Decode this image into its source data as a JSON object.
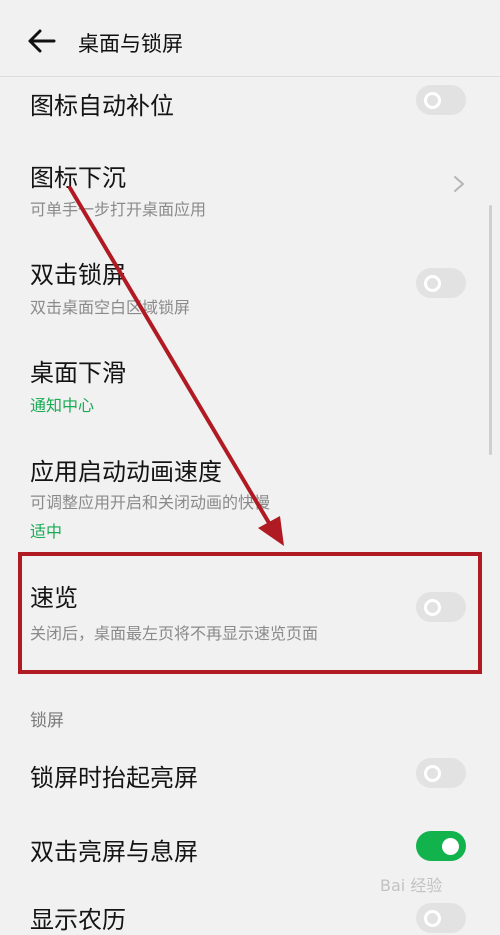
{
  "header": {
    "back_icon": "arrow-left-icon",
    "title": "桌面与锁屏"
  },
  "items": [
    {
      "title": "图标自动补位",
      "control": "toggle",
      "on": false
    },
    {
      "title": "图标下沉",
      "subtitle": "可单手一步打开桌面应用",
      "control": "chevron"
    },
    {
      "title": "双击锁屏",
      "subtitle": "双击桌面空白区域锁屏",
      "control": "toggle",
      "on": false
    },
    {
      "title": "桌面下滑",
      "value": "通知中心"
    },
    {
      "title": "应用启动动画速度",
      "subtitle": "可调整应用开启和关闭动画的快慢",
      "value": "适中"
    },
    {
      "title": "速览",
      "subtitle": "关闭后，桌面最左页将不再显示速览页面",
      "control": "toggle",
      "on": false
    }
  ],
  "lock_section": {
    "label": "锁屏",
    "items": [
      {
        "title": "锁屏时抬起亮屏",
        "control": "toggle",
        "on": false
      },
      {
        "title": "双击亮屏与息屏",
        "control": "toggle",
        "on": true
      },
      {
        "title": "显示农历",
        "control": "toggle",
        "on": false
      }
    ]
  },
  "watermark": "Bai 经验",
  "colors": {
    "accent_green": "#12b24d",
    "annotation_red": "#b01a22",
    "background": "#f1f1f1"
  }
}
